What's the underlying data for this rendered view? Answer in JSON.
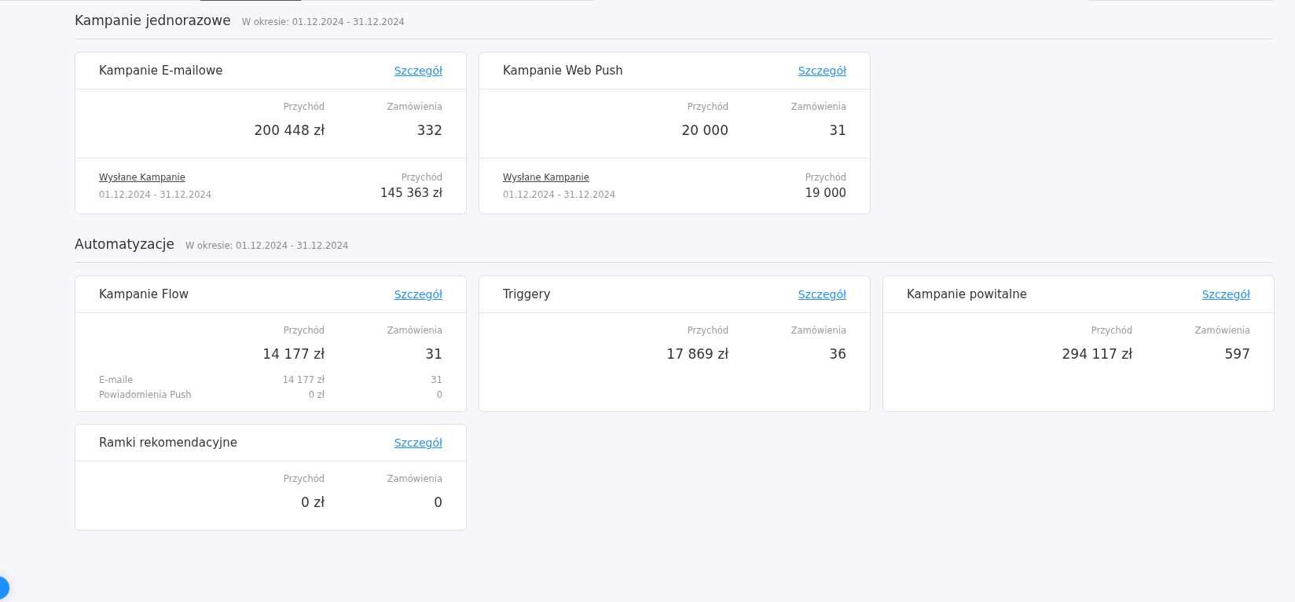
{
  "sections": [
    {
      "title": "Kampanie jednorazowe",
      "period": "W okresie: 01.12.2024 - 31.12.2024",
      "cards": [
        {
          "title": "Kampanie E-mailowe",
          "link": "Szczegół",
          "metrics": [
            {
              "label": "Przychód",
              "value": "200 448 zł"
            },
            {
              "label": "Zamówienia",
              "value": "332"
            }
          ],
          "footer": {
            "link": "Wysłane Kampanie",
            "range": "01.12.2024 - 31.12.2024",
            "label": "Przychód",
            "value": "145 363 zł"
          }
        },
        {
          "title": "Kampanie Web Push",
          "link": "Szczegół",
          "metrics": [
            {
              "label": "Przychód",
              "value": "20 000"
            },
            {
              "label": "Zamówienia",
              "value": "31"
            }
          ],
          "footer": {
            "link": "Wysłane Kampanie",
            "range": "01.12.2024 - 31.12.2024",
            "label": "Przychód",
            "value": "19 000"
          }
        }
      ]
    },
    {
      "title": "Automatyzacje",
      "period": "W okresie: 01.12.2024 - 31.12.2024",
      "cards": [
        {
          "title": "Kampanie Flow",
          "link": "Szczegół",
          "metrics": [
            {
              "label": "Przychód",
              "value": "14 177 zł"
            },
            {
              "label": "Zamówienia",
              "value": "31"
            }
          ],
          "breakdown": [
            {
              "label": "E-maile",
              "revenue": "14 177 zł",
              "orders": "31"
            },
            {
              "label": "Powiadomienia Push",
              "revenue": "0 zł",
              "orders": "0"
            }
          ]
        },
        {
          "title": "Triggery",
          "link": "Szczegół",
          "metrics": [
            {
              "label": "Przychód",
              "value": "17 869 zł"
            },
            {
              "label": "Zamówienia",
              "value": "36"
            }
          ]
        },
        {
          "title": "Kampanie powitalne",
          "link": "Szczegół",
          "metrics": [
            {
              "label": "Przychód",
              "value": "294 117 zł"
            },
            {
              "label": "Zamówienia",
              "value": "597"
            }
          ]
        },
        {
          "title": "Ramki rekomendacyjne",
          "link": "Szczegół",
          "metrics": [
            {
              "label": "Przychód",
              "value": "0 zł"
            },
            {
              "label": "Zamówienia",
              "value": "0"
            }
          ]
        }
      ]
    }
  ]
}
